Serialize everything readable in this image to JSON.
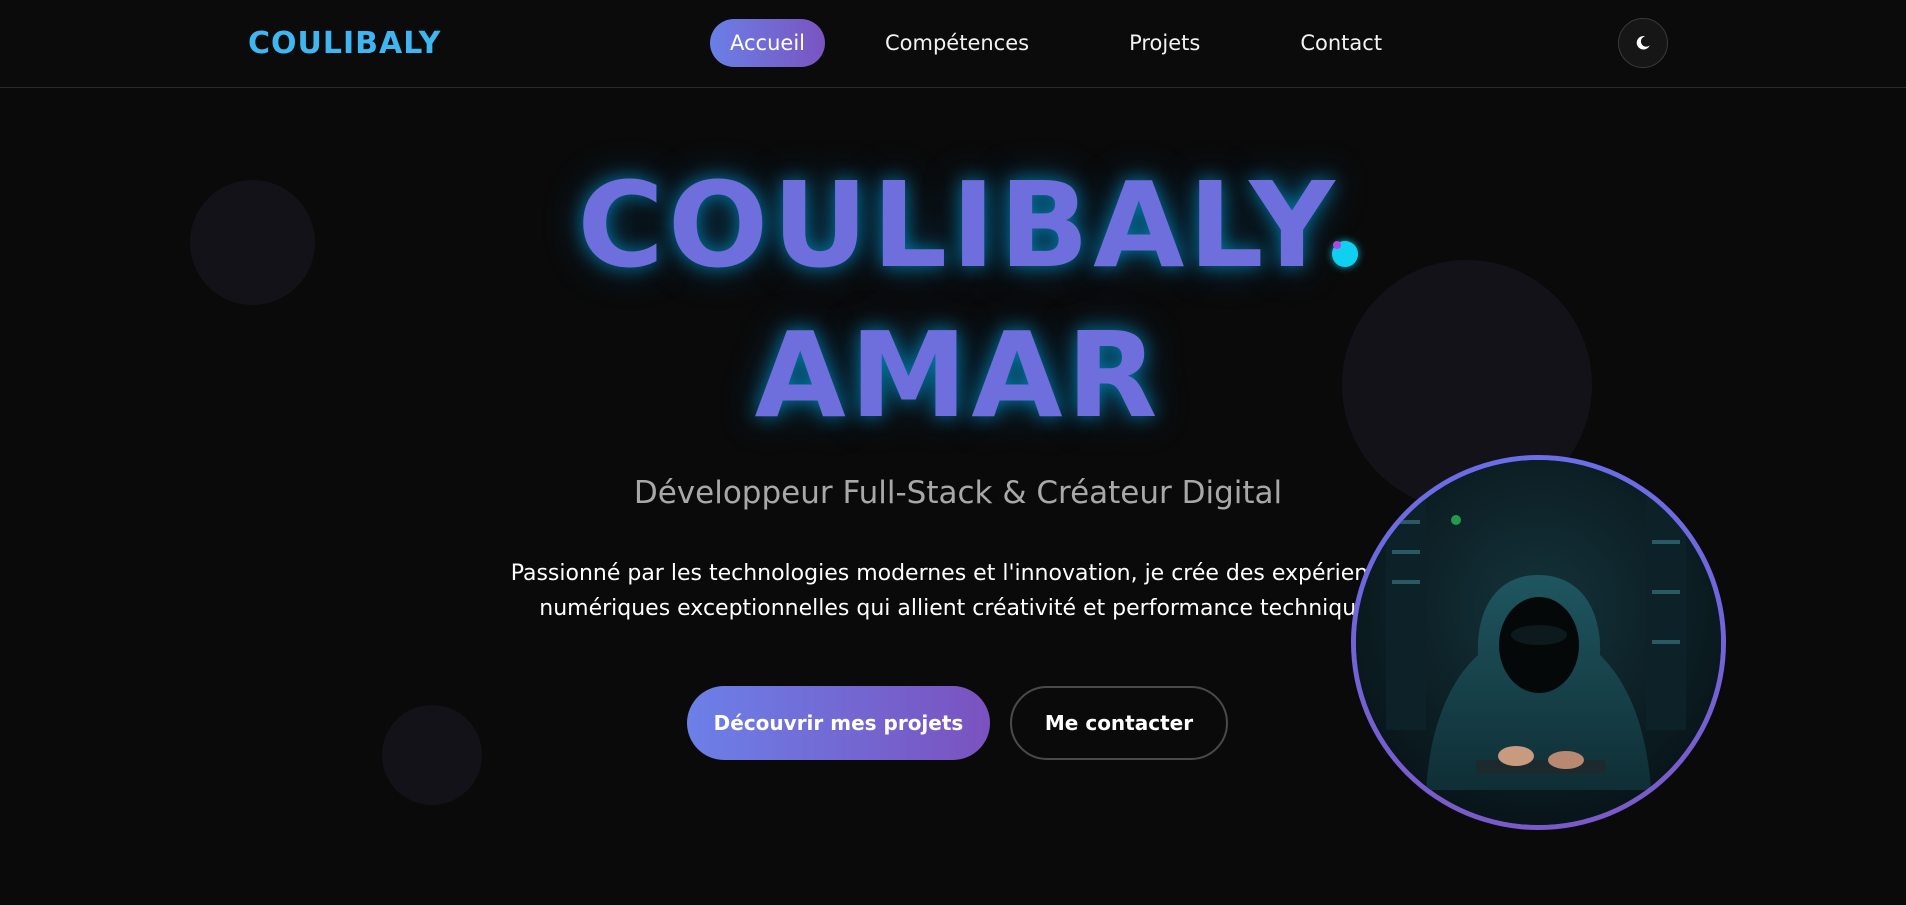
{
  "navbar": {
    "logo": "COULIBALY",
    "items": [
      {
        "label": "Accueil",
        "active": true
      },
      {
        "label": "Compétences",
        "active": false
      },
      {
        "label": "Projets",
        "active": false
      },
      {
        "label": "Contact",
        "active": false
      }
    ],
    "theme_toggle_icon": "moon-icon"
  },
  "hero": {
    "title_line1": "COULIBALY",
    "title_line2": "AMAR",
    "subtitle": "Développeur Full-Stack & Créateur Digital",
    "description": "Passionné par les technologies modernes et l'innovation, je crée des expériences numériques exceptionnelles qui allient créativité et performance technique.",
    "primary_button": "Découvrir mes projets",
    "secondary_button": "Me contacter",
    "avatar_icon": "hooded-hacker-avatar"
  },
  "colors": {
    "background": "#0a0a0a",
    "logo": "#3fb6f2",
    "accent_start": "#6a7fe6",
    "accent_end": "#7a54c0",
    "title": "#6e6fdc",
    "title_glow": "#00beff",
    "dot": "#0fd0f0"
  }
}
